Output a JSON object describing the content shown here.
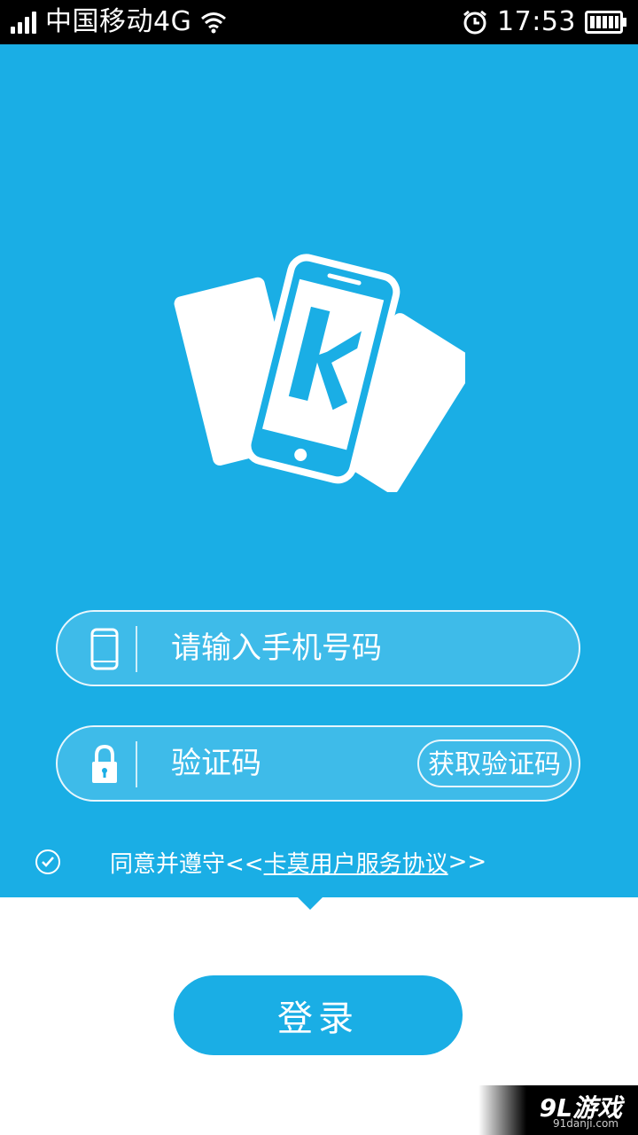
{
  "status_bar": {
    "carrier": "中国移动4G",
    "time": "17:53",
    "icons": [
      "signal-icon",
      "wifi-icon",
      "alarm-icon",
      "battery-icon"
    ]
  },
  "form": {
    "phone_placeholder": "请输入手机号码",
    "code_placeholder": "验证码",
    "get_code_label": "获取验证码"
  },
  "agreement": {
    "prefix": "同意并遵守<<",
    "link": "卡莫用户服务协议",
    "suffix": ">>"
  },
  "login_label": "登录",
  "watermark": {
    "main": "9L游戏",
    "sub": "91danji.com"
  },
  "colors": {
    "brand_blue": "#1aaee5",
    "white": "#ffffff"
  }
}
